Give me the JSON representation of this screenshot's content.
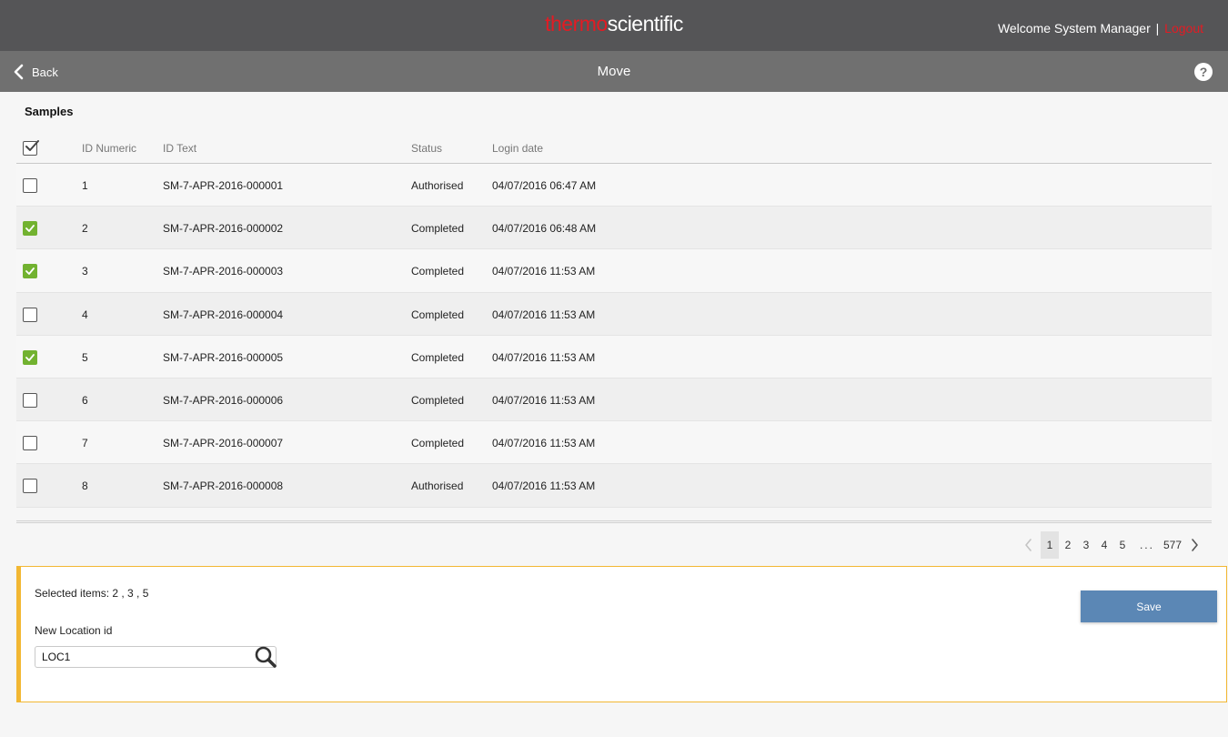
{
  "header": {
    "brand_part1": "thermo",
    "brand_part2": "scientific",
    "welcome": "Welcome System Manager",
    "separator": "|",
    "logout": "Logout"
  },
  "subheader": {
    "back_label": "Back",
    "title": "Move",
    "help_label": "?"
  },
  "samples": {
    "title": "Samples",
    "columns": [
      "ID Numeric",
      "ID Text",
      "Status",
      "Login date"
    ],
    "rows": [
      {
        "checked": false,
        "id": "1",
        "text": "SM-7-APR-2016-000001",
        "status": "Authorised",
        "date": "04/07/2016 06:47 AM"
      },
      {
        "checked": true,
        "id": "2",
        "text": "SM-7-APR-2016-000002",
        "status": "Completed",
        "date": "04/07/2016 06:48 AM"
      },
      {
        "checked": true,
        "id": "3",
        "text": "SM-7-APR-2016-000003",
        "status": "Completed",
        "date": "04/07/2016 11:53 AM"
      },
      {
        "checked": false,
        "id": "4",
        "text": "SM-7-APR-2016-000004",
        "status": "Completed",
        "date": "04/07/2016 11:53 AM"
      },
      {
        "checked": true,
        "id": "5",
        "text": "SM-7-APR-2016-000005",
        "status": "Completed",
        "date": "04/07/2016 11:53 AM"
      },
      {
        "checked": false,
        "id": "6",
        "text": "SM-7-APR-2016-000006",
        "status": "Completed",
        "date": "04/07/2016 11:53 AM"
      },
      {
        "checked": false,
        "id": "7",
        "text": "SM-7-APR-2016-000007",
        "status": "Completed",
        "date": "04/07/2016 11:53 AM"
      },
      {
        "checked": false,
        "id": "8",
        "text": "SM-7-APR-2016-000008",
        "status": "Authorised",
        "date": "04/07/2016 11:53 AM"
      }
    ]
  },
  "pagination": {
    "pages": [
      "1",
      "2",
      "3",
      "4",
      "5"
    ],
    "ellipsis": "...",
    "last_page": "577",
    "current": "1"
  },
  "panel": {
    "selected_text": "Selected items: 2 , 3 , 5",
    "location_label": "New Location id",
    "location_value": "LOC1",
    "save_label": "Save"
  },
  "colors": {
    "brand_red": "#e31b23",
    "topbar": "#555557",
    "subbar": "#707070",
    "check_green": "#72b230",
    "panel_accent": "#f2b733",
    "save_blue": "#5b87b5"
  }
}
